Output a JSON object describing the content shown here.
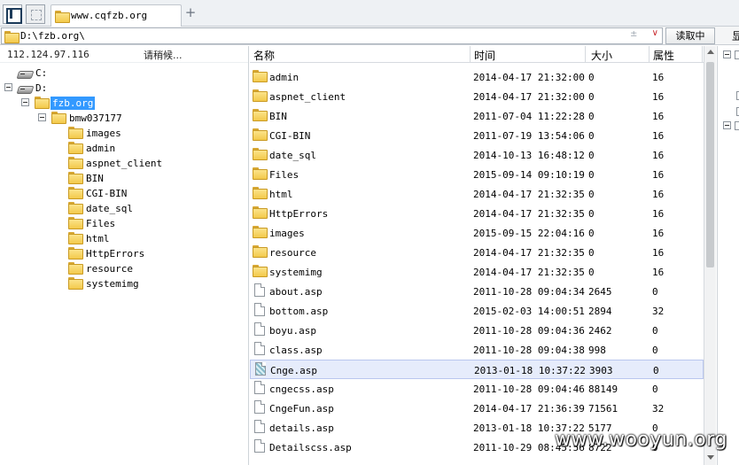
{
  "tab": {
    "title": "www.cqfzb.org",
    "add_label": "+"
  },
  "address": {
    "path": "D:\\fzb.org\\",
    "separator": "±",
    "dropdown": "∨",
    "read_button": "读取中",
    "side_label": "显"
  },
  "left_panel": {
    "ip": "112.124.97.116",
    "status": "请稍候...",
    "tree": [
      {
        "label": "C:",
        "type": "drive"
      },
      {
        "label": "D:",
        "type": "drive"
      },
      {
        "label": "fzb.org",
        "type": "folder",
        "selected": true
      },
      {
        "label": "bmw037177",
        "type": "folder"
      },
      {
        "label": "images",
        "type": "folder"
      },
      {
        "label": "admin",
        "type": "folder"
      },
      {
        "label": "aspnet_client",
        "type": "folder"
      },
      {
        "label": "BIN",
        "type": "folder"
      },
      {
        "label": "CGI-BIN",
        "type": "folder"
      },
      {
        "label": "date_sql",
        "type": "folder"
      },
      {
        "label": "Files",
        "type": "folder"
      },
      {
        "label": "html",
        "type": "folder"
      },
      {
        "label": "HttpErrors",
        "type": "folder"
      },
      {
        "label": "resource",
        "type": "folder"
      },
      {
        "label": "systemimg",
        "type": "folder"
      }
    ]
  },
  "file_list": {
    "columns": {
      "name": "名称",
      "time": "时间",
      "size": "大小",
      "attr": "属性"
    },
    "rows": [
      {
        "name": "admin",
        "time": "2014-04-17 21:32:00",
        "size": "0",
        "attr": "16",
        "type": "folder"
      },
      {
        "name": "aspnet_client",
        "time": "2014-04-17 21:32:00",
        "size": "0",
        "attr": "16",
        "type": "folder"
      },
      {
        "name": "BIN",
        "time": "2011-07-04 11:22:28",
        "size": "0",
        "attr": "16",
        "type": "folder"
      },
      {
        "name": "CGI-BIN",
        "time": "2011-07-19 13:54:06",
        "size": "0",
        "attr": "16",
        "type": "folder"
      },
      {
        "name": "date_sql",
        "time": "2014-10-13 16:48:12",
        "size": "0",
        "attr": "16",
        "type": "folder"
      },
      {
        "name": "Files",
        "time": "2015-09-14 09:10:19",
        "size": "0",
        "attr": "16",
        "type": "folder"
      },
      {
        "name": "html",
        "time": "2014-04-17 21:32:35",
        "size": "0",
        "attr": "16",
        "type": "folder"
      },
      {
        "name": "HttpErrors",
        "time": "2014-04-17 21:32:35",
        "size": "0",
        "attr": "16",
        "type": "folder"
      },
      {
        "name": "images",
        "time": "2015-09-15 22:04:16",
        "size": "0",
        "attr": "16",
        "type": "folder"
      },
      {
        "name": "resource",
        "time": "2014-04-17 21:32:35",
        "size": "0",
        "attr": "16",
        "type": "folder"
      },
      {
        "name": "systemimg",
        "time": "2014-04-17 21:32:35",
        "size": "0",
        "attr": "16",
        "type": "folder"
      },
      {
        "name": "about.asp",
        "time": "2011-10-28 09:04:34",
        "size": "2645",
        "attr": "0",
        "type": "file"
      },
      {
        "name": "bottom.asp",
        "time": "2015-02-03 14:00:51",
        "size": "2894",
        "attr": "32",
        "type": "file"
      },
      {
        "name": "boyu.asp",
        "time": "2011-10-28 09:04:36",
        "size": "2462",
        "attr": "0",
        "type": "file"
      },
      {
        "name": "class.asp",
        "time": "2011-10-28 09:04:38",
        "size": "998",
        "attr": "0",
        "type": "file"
      },
      {
        "name": "Cnge.asp",
        "time": "2013-01-18 10:37:22",
        "size": "3903",
        "attr": "0",
        "type": "file",
        "highlighted": true
      },
      {
        "name": "cngecss.asp",
        "time": "2011-10-28 09:04:46",
        "size": "88149",
        "attr": "0",
        "type": "file"
      },
      {
        "name": "CngeFun.asp",
        "time": "2014-04-17 21:36:39",
        "size": "71561",
        "attr": "32",
        "type": "file"
      },
      {
        "name": "details.asp",
        "time": "2013-01-18 10:37:22",
        "size": "5177",
        "attr": "0",
        "type": "file"
      },
      {
        "name": "Detailscss.asp",
        "time": "2011-10-29 08:45:56",
        "size": "8722",
        "attr": "0",
        "type": "file"
      }
    ]
  },
  "watermark": "www.wooyun.org"
}
